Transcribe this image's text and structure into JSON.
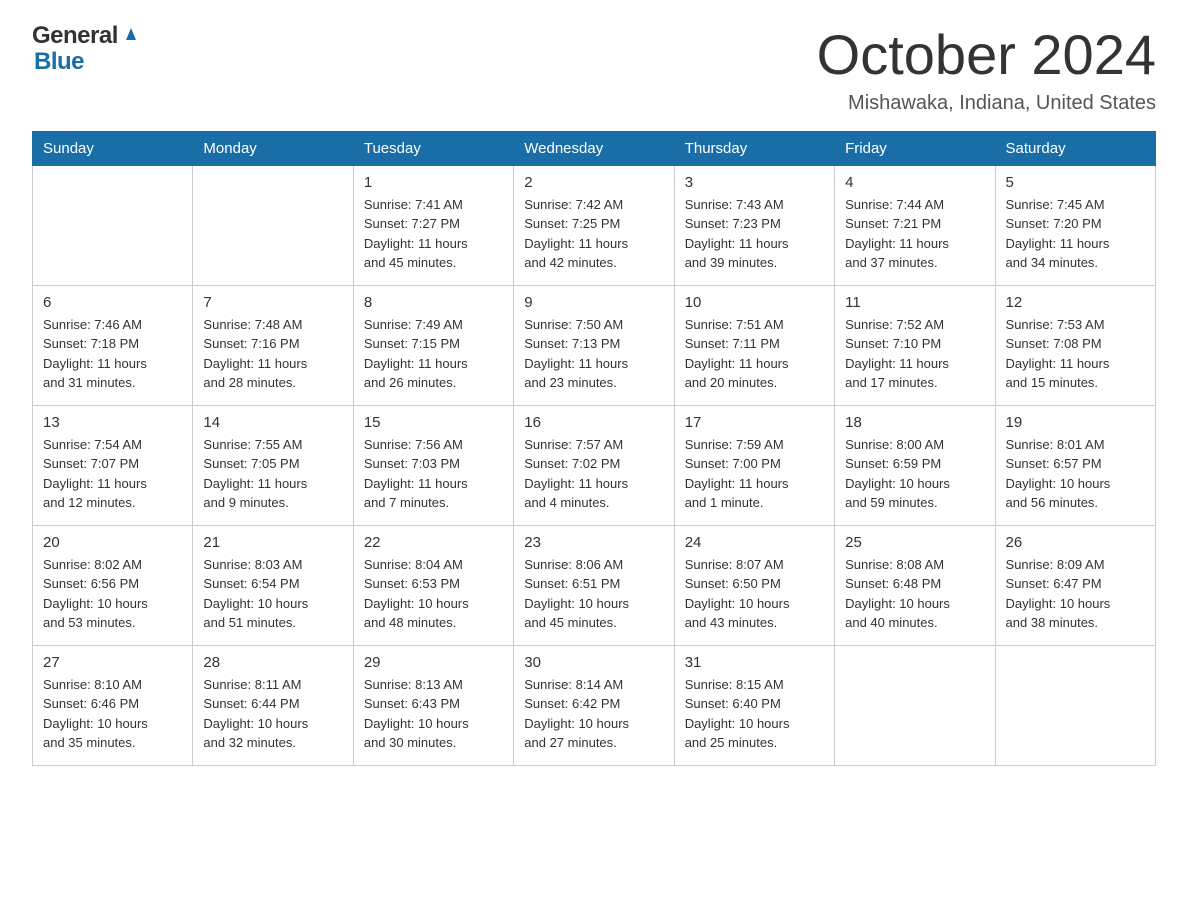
{
  "logo": {
    "general": "General",
    "blue": "Blue"
  },
  "title": "October 2024",
  "location": "Mishawaka, Indiana, United States",
  "days_of_week": [
    "Sunday",
    "Monday",
    "Tuesday",
    "Wednesday",
    "Thursday",
    "Friday",
    "Saturday"
  ],
  "weeks": [
    [
      {
        "day": "",
        "info": ""
      },
      {
        "day": "",
        "info": ""
      },
      {
        "day": "1",
        "info": "Sunrise: 7:41 AM\nSunset: 7:27 PM\nDaylight: 11 hours\nand 45 minutes."
      },
      {
        "day": "2",
        "info": "Sunrise: 7:42 AM\nSunset: 7:25 PM\nDaylight: 11 hours\nand 42 minutes."
      },
      {
        "day": "3",
        "info": "Sunrise: 7:43 AM\nSunset: 7:23 PM\nDaylight: 11 hours\nand 39 minutes."
      },
      {
        "day": "4",
        "info": "Sunrise: 7:44 AM\nSunset: 7:21 PM\nDaylight: 11 hours\nand 37 minutes."
      },
      {
        "day": "5",
        "info": "Sunrise: 7:45 AM\nSunset: 7:20 PM\nDaylight: 11 hours\nand 34 minutes."
      }
    ],
    [
      {
        "day": "6",
        "info": "Sunrise: 7:46 AM\nSunset: 7:18 PM\nDaylight: 11 hours\nand 31 minutes."
      },
      {
        "day": "7",
        "info": "Sunrise: 7:48 AM\nSunset: 7:16 PM\nDaylight: 11 hours\nand 28 minutes."
      },
      {
        "day": "8",
        "info": "Sunrise: 7:49 AM\nSunset: 7:15 PM\nDaylight: 11 hours\nand 26 minutes."
      },
      {
        "day": "9",
        "info": "Sunrise: 7:50 AM\nSunset: 7:13 PM\nDaylight: 11 hours\nand 23 minutes."
      },
      {
        "day": "10",
        "info": "Sunrise: 7:51 AM\nSunset: 7:11 PM\nDaylight: 11 hours\nand 20 minutes."
      },
      {
        "day": "11",
        "info": "Sunrise: 7:52 AM\nSunset: 7:10 PM\nDaylight: 11 hours\nand 17 minutes."
      },
      {
        "day": "12",
        "info": "Sunrise: 7:53 AM\nSunset: 7:08 PM\nDaylight: 11 hours\nand 15 minutes."
      }
    ],
    [
      {
        "day": "13",
        "info": "Sunrise: 7:54 AM\nSunset: 7:07 PM\nDaylight: 11 hours\nand 12 minutes."
      },
      {
        "day": "14",
        "info": "Sunrise: 7:55 AM\nSunset: 7:05 PM\nDaylight: 11 hours\nand 9 minutes."
      },
      {
        "day": "15",
        "info": "Sunrise: 7:56 AM\nSunset: 7:03 PM\nDaylight: 11 hours\nand 7 minutes."
      },
      {
        "day": "16",
        "info": "Sunrise: 7:57 AM\nSunset: 7:02 PM\nDaylight: 11 hours\nand 4 minutes."
      },
      {
        "day": "17",
        "info": "Sunrise: 7:59 AM\nSunset: 7:00 PM\nDaylight: 11 hours\nand 1 minute."
      },
      {
        "day": "18",
        "info": "Sunrise: 8:00 AM\nSunset: 6:59 PM\nDaylight: 10 hours\nand 59 minutes."
      },
      {
        "day": "19",
        "info": "Sunrise: 8:01 AM\nSunset: 6:57 PM\nDaylight: 10 hours\nand 56 minutes."
      }
    ],
    [
      {
        "day": "20",
        "info": "Sunrise: 8:02 AM\nSunset: 6:56 PM\nDaylight: 10 hours\nand 53 minutes."
      },
      {
        "day": "21",
        "info": "Sunrise: 8:03 AM\nSunset: 6:54 PM\nDaylight: 10 hours\nand 51 minutes."
      },
      {
        "day": "22",
        "info": "Sunrise: 8:04 AM\nSunset: 6:53 PM\nDaylight: 10 hours\nand 48 minutes."
      },
      {
        "day": "23",
        "info": "Sunrise: 8:06 AM\nSunset: 6:51 PM\nDaylight: 10 hours\nand 45 minutes."
      },
      {
        "day": "24",
        "info": "Sunrise: 8:07 AM\nSunset: 6:50 PM\nDaylight: 10 hours\nand 43 minutes."
      },
      {
        "day": "25",
        "info": "Sunrise: 8:08 AM\nSunset: 6:48 PM\nDaylight: 10 hours\nand 40 minutes."
      },
      {
        "day": "26",
        "info": "Sunrise: 8:09 AM\nSunset: 6:47 PM\nDaylight: 10 hours\nand 38 minutes."
      }
    ],
    [
      {
        "day": "27",
        "info": "Sunrise: 8:10 AM\nSunset: 6:46 PM\nDaylight: 10 hours\nand 35 minutes."
      },
      {
        "day": "28",
        "info": "Sunrise: 8:11 AM\nSunset: 6:44 PM\nDaylight: 10 hours\nand 32 minutes."
      },
      {
        "day": "29",
        "info": "Sunrise: 8:13 AM\nSunset: 6:43 PM\nDaylight: 10 hours\nand 30 minutes."
      },
      {
        "day": "30",
        "info": "Sunrise: 8:14 AM\nSunset: 6:42 PM\nDaylight: 10 hours\nand 27 minutes."
      },
      {
        "day": "31",
        "info": "Sunrise: 8:15 AM\nSunset: 6:40 PM\nDaylight: 10 hours\nand 25 minutes."
      },
      {
        "day": "",
        "info": ""
      },
      {
        "day": "",
        "info": ""
      }
    ]
  ]
}
